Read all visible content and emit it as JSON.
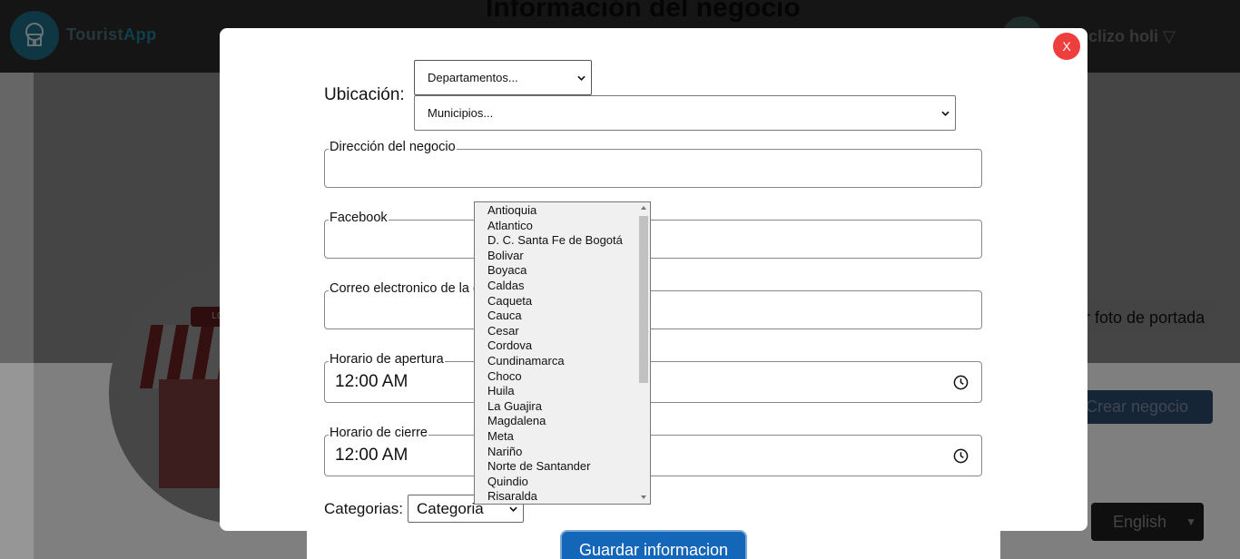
{
  "background": {
    "brand": {
      "part1": "Tourist",
      "part2": "App"
    },
    "heading": "Información del negocio",
    "user_name": "ocliz​o holi ▽",
    "cover_sign": "LO",
    "cover_button": "tar foto de portada",
    "create_button": "Crear negocio",
    "language": {
      "selected": "English"
    }
  },
  "modal": {
    "close_label": "X",
    "location": {
      "label": "Ubicación:",
      "departments_placeholder": "Departamentos...",
      "municipalities_placeholder": "Municipios..."
    },
    "fields": {
      "address": {
        "label": "Dirección del negocio",
        "value": ""
      },
      "facebook": {
        "label": "Facebook",
        "value": ""
      },
      "email": {
        "label": "Correo electronico de la e",
        "value": ""
      },
      "opening": {
        "label": "Horario de apertura",
        "value": "12:00 AM"
      },
      "closing": {
        "label": "Horario de cierre",
        "value": "12:00 AM"
      }
    },
    "category": {
      "label": "Categorias:",
      "selected": "Categoria"
    },
    "save_button": "Guardar informacion"
  },
  "department_options": [
    "Antioquia",
    "Atlantico",
    "D. C. Santa Fe de Bogotá",
    "Bolivar",
    "Boyaca",
    "Caldas",
    "Caqueta",
    "Cauca",
    "Cesar",
    "Cordova",
    "Cundinamarca",
    "Choco",
    "Huila",
    "La Guajira",
    "Magdalena",
    "Meta",
    "Nariño",
    "Norte de Santander",
    "Quindio",
    "Risaralda"
  ],
  "colors": {
    "close": "#ee3e3e",
    "save": "#1466b8",
    "brand_accent": "#1f7f99"
  }
}
